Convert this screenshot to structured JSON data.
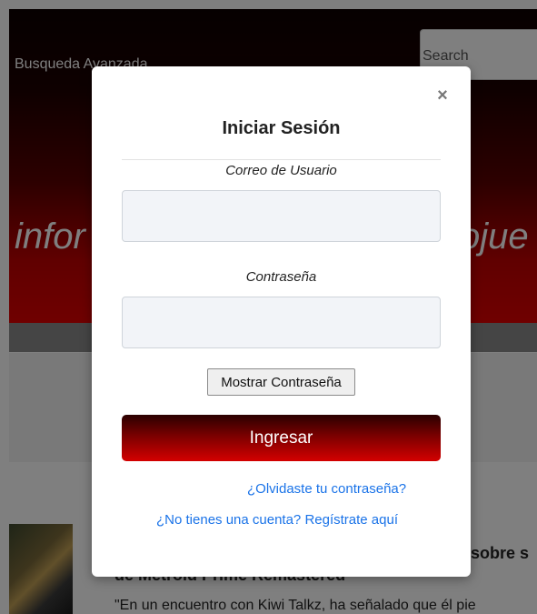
{
  "background": {
    "advanced_search": "Busqueda Avanzada",
    "search_placeholder": "Search",
    "banner_left": "infor",
    "banner_right": "ojue",
    "article_title_fragment": "sobre s",
    "article_title_line2": "de Metroid Prime Remastered",
    "article_excerpt": "\"En un encuentro con Kiwi Talkz, ha señalado que él pie"
  },
  "modal": {
    "close_label": "×",
    "title": "Iniciar Sesión",
    "email_label": "Correo de Usuario",
    "email_value": "",
    "password_label": "Contraseña",
    "password_value": "",
    "show_password_label": "Mostrar Contraseña",
    "submit_label": "Ingresar",
    "forgot_link": "¿Olvidaste tu contraseña?",
    "register_link": "¿No tienes una cuenta? Regístrate aquí"
  },
  "colors": {
    "brand_red": "#d40000",
    "link_blue": "#1a73e8"
  }
}
